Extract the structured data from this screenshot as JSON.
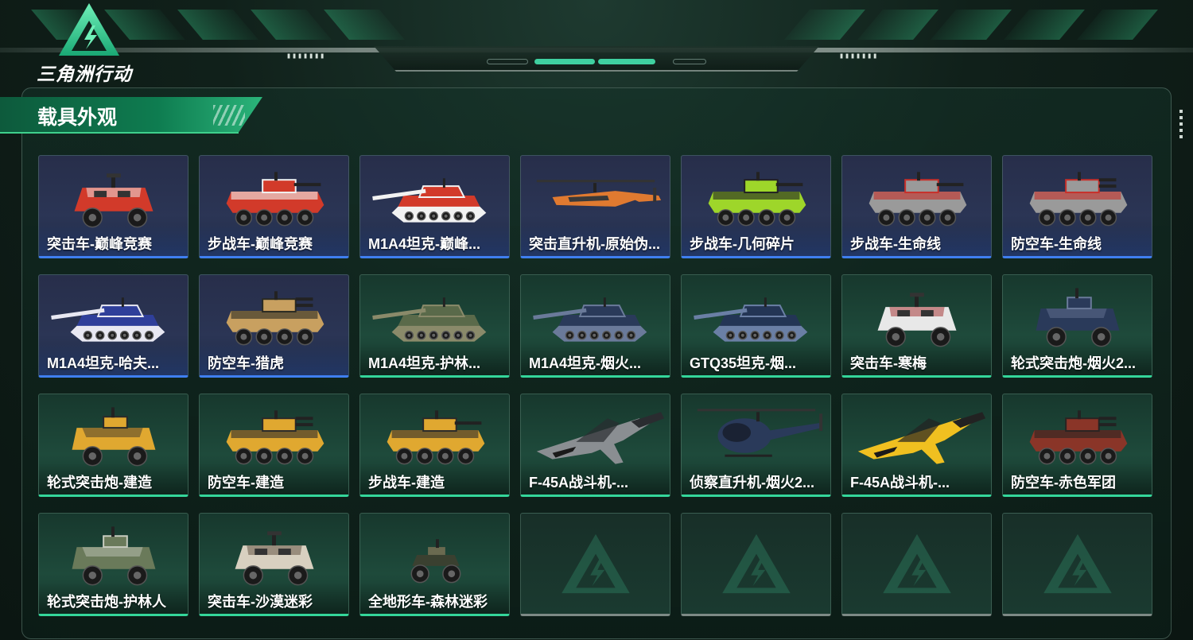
{
  "app": {
    "logo_text": "三角洲行动"
  },
  "section": {
    "title": "载具外观"
  },
  "colors": {
    "accent_green": "#34d69a",
    "rarity_blue": "#3f7ff0",
    "empty_gray": "#7d8a85"
  },
  "items": [
    {
      "name": "突击车-巅峰竞赛",
      "rarity": "blue",
      "icon": "armored-car-icon",
      "palette": [
        "#d23a2a",
        "#f2f2f2"
      ]
    },
    {
      "name": "步战车-巅峰竞赛",
      "rarity": "blue",
      "icon": "ifv-icon",
      "palette": [
        "#d23a2a",
        "#f2f2f2"
      ]
    },
    {
      "name": "M1A4坦克-巅峰...",
      "rarity": "blue",
      "icon": "tank-icon",
      "palette": [
        "#d23a2a",
        "#f2f2f2"
      ]
    },
    {
      "name": "突击直升机-原始伪...",
      "rarity": "blue",
      "icon": "attack-helicopter-icon",
      "palette": [
        "#3a3a3a",
        "#e07a30"
      ]
    },
    {
      "name": "步战车-几何碎片",
      "rarity": "blue",
      "icon": "ifv-icon",
      "palette": [
        "#9ed62a",
        "#222222"
      ]
    },
    {
      "name": "步战车-生命线",
      "rarity": "blue",
      "icon": "ifv-icon",
      "palette": [
        "#9a9a9a",
        "#c8302a"
      ]
    },
    {
      "name": "防空车-生命线",
      "rarity": "blue",
      "icon": "anti-air-icon",
      "palette": [
        "#9a9a9a",
        "#c8302a"
      ]
    },
    {
      "name": "M1A4坦克-哈夫...",
      "rarity": "blue",
      "icon": "tank-icon",
      "palette": [
        "#2f3f9a",
        "#e8e8f2"
      ]
    },
    {
      "name": "防空车-猎虎",
      "rarity": "blue",
      "icon": "anti-air-icon",
      "palette": [
        "#c8a060",
        "#2a2a22"
      ]
    },
    {
      "name": "M1A4坦克-护林...",
      "rarity": "green",
      "icon": "tank-icon",
      "palette": [
        "#5a6a4a",
        "#8a8a6a"
      ]
    },
    {
      "name": "M1A4坦克-烟火...",
      "rarity": "green",
      "icon": "tank-icon",
      "palette": [
        "#2a3a5a",
        "#6a7a9a"
      ]
    },
    {
      "name": "GTQ35坦克-烟...",
      "rarity": "green",
      "icon": "tank-icon",
      "palette": [
        "#233555",
        "#6a7fa5"
      ]
    },
    {
      "name": "突击车-寒梅",
      "rarity": "green",
      "icon": "armored-car-icon",
      "palette": [
        "#e8e8e8",
        "#a02a2a"
      ]
    },
    {
      "name": "轮式突击炮-烟火2...",
      "rarity": "green",
      "icon": "wheeled-gun-icon",
      "palette": [
        "#2a3a5a",
        "#6a7a9a"
      ]
    },
    {
      "name": "轮式突击炮-建造",
      "rarity": "green",
      "icon": "wheeled-gun-icon",
      "palette": [
        "#e0a830",
        "#2a2a2a"
      ]
    },
    {
      "name": "防空车-建造",
      "rarity": "green",
      "icon": "anti-air-icon",
      "palette": [
        "#e0a830",
        "#2a2a2a"
      ]
    },
    {
      "name": "步战车-建造",
      "rarity": "green",
      "icon": "ifv-icon",
      "palette": [
        "#e0a830",
        "#2a2a2a"
      ]
    },
    {
      "name": "F-45A战斗机-...",
      "rarity": "green",
      "icon": "fighter-jet-icon",
      "palette": [
        "#8a8e92",
        "#2a2c30"
      ]
    },
    {
      "name": "侦察直升机-烟火2...",
      "rarity": "green",
      "icon": "scout-helicopter-icon",
      "palette": [
        "#2a3a5a",
        "#7a8aaa"
      ]
    },
    {
      "name": "F-45A战斗机-...",
      "rarity": "green",
      "icon": "fighter-jet-icon",
      "palette": [
        "#f0c020",
        "#222222"
      ]
    },
    {
      "name": "防空车-赤色军团",
      "rarity": "green",
      "icon": "anti-air-icon",
      "palette": [
        "#8a3528",
        "#2a2422"
      ]
    },
    {
      "name": "轮式突击炮-护林人",
      "rarity": "green",
      "icon": "wheeled-gun-icon",
      "palette": [
        "#6a7a5a",
        "#c8ccc0"
      ]
    },
    {
      "name": "突击车-沙漠迷彩",
      "rarity": "green",
      "icon": "armored-car-icon",
      "palette": [
        "#d8d0c0",
        "#5a4a3a"
      ]
    },
    {
      "name": "全地形车-森林迷彩",
      "rarity": "green",
      "icon": "atv-icon",
      "palette": [
        "#3a4030",
        "#6a6a50"
      ]
    },
    {
      "name": "",
      "rarity": "empty",
      "icon": "empty-slot-icon"
    },
    {
      "name": "",
      "rarity": "empty",
      "icon": "empty-slot-icon"
    },
    {
      "name": "",
      "rarity": "empty",
      "icon": "empty-slot-icon"
    },
    {
      "name": "",
      "rarity": "empty",
      "icon": "empty-slot-icon"
    }
  ]
}
